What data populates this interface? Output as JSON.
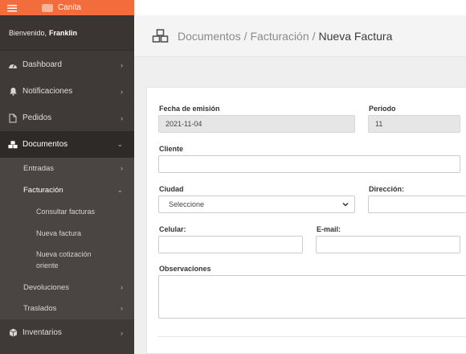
{
  "brand": {
    "name": "Canita",
    "menu_icon": "menu-icon"
  },
  "welcome": {
    "greeting": "Bienvenido,",
    "user": "Franklin"
  },
  "sidebar": {
    "items": [
      {
        "label": "Dashboard",
        "icon": "tachometer-icon"
      },
      {
        "label": "Notificaciones",
        "icon": "bell-icon"
      },
      {
        "label": "Pedidos",
        "icon": "file-icon"
      },
      {
        "label": "Documentos",
        "icon": "cubes-icon"
      },
      {
        "label": "Inventarios",
        "icon": "cube-icon"
      }
    ],
    "documentos_sub": [
      {
        "label": "Entradas"
      },
      {
        "label": "Facturación"
      },
      {
        "label": "Devoluciones"
      },
      {
        "label": "Traslados"
      }
    ],
    "facturacion_sub": [
      {
        "label": "Consultar facturas"
      },
      {
        "label": "Nueva factura"
      },
      {
        "label": "Nueva cotización oriente"
      }
    ]
  },
  "breadcrumb": {
    "part1": "Documentos",
    "part2": "Facturación",
    "current": "Nueva Factura",
    "separator": "/"
  },
  "form": {
    "fecha_label": "Fecha de emisión",
    "fecha_value": "2021-11-04",
    "periodo_label": "Periodo",
    "periodo_value": "11",
    "cliente_label": "Cliente",
    "ciudad_label": "Ciudad",
    "ciudad_value": "Seleccione",
    "direccion_label": "Dirección:",
    "celular_label": "Celular:",
    "email_label": "E-mail:",
    "observaciones_label": "Observaciones"
  },
  "colors": {
    "accent": "#f26c3c",
    "sidebar": "#3f3a38"
  }
}
